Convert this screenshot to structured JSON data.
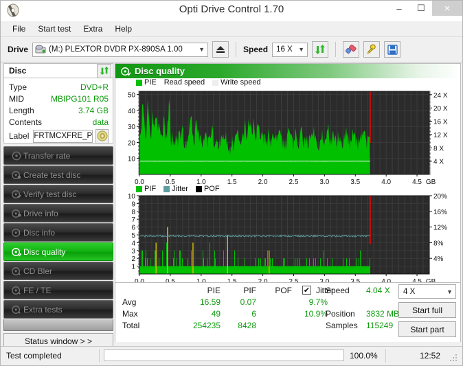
{
  "window": {
    "title": "Opti Drive Control 1.70",
    "icon": "disc-icon",
    "minimize": "–",
    "maximize": "☐",
    "close": "×"
  },
  "menu": {
    "items": [
      "File",
      "Start test",
      "Extra",
      "Help"
    ]
  },
  "toolbar": {
    "drive_label": "Drive",
    "drive_value": "(M:)   PLEXTOR DVDR   PX-890SA 1.00",
    "drive_icon": "drive-icon",
    "eject_icon": "eject-icon",
    "speed_label": "Speed",
    "speed_value": "16 X",
    "refresh_icon": "refresh-icon",
    "erase_icon": "erase-icon",
    "bitsetting_icon": "bitsetting-icon",
    "save_icon": "save-icon"
  },
  "disc": {
    "header": "Disc",
    "refresh_icon": "refresh-icon",
    "rows": [
      {
        "key": "Type",
        "value": "DVD+R"
      },
      {
        "key": "MID",
        "value": "MBIPG101 R05"
      },
      {
        "key": "Length",
        "value": "3.74 GB"
      },
      {
        "key": "Contents",
        "value": "data"
      }
    ],
    "label_key": "Label",
    "label_value": "FRTMCXFRE_P",
    "label_btn_icon": "disc-icon"
  },
  "sidebar": {
    "items": [
      {
        "label": "Transfer rate",
        "icon": "disc-icon",
        "active": false
      },
      {
        "label": "Create test disc",
        "icon": "disc-write-icon",
        "active": false
      },
      {
        "label": "Verify test disc",
        "icon": "disc-check-icon",
        "active": false
      },
      {
        "label": "Drive info",
        "icon": "drive-info-icon",
        "active": false
      },
      {
        "label": "Disc info",
        "icon": "disc-info-icon",
        "active": false
      },
      {
        "label": "Disc quality",
        "icon": "disc-quality-icon",
        "active": true
      },
      {
        "label": "CD Bler",
        "icon": "disc-bler-icon",
        "active": false
      },
      {
        "label": "FE / TE",
        "icon": "disc-fete-icon",
        "active": false
      },
      {
        "label": "Extra tests",
        "icon": "disc-extra-icon",
        "active": false
      }
    ],
    "status_window": "Status window > >"
  },
  "panel": {
    "title": "Disc quality",
    "icon": "disc-quality-icon"
  },
  "chart_data": [
    {
      "type": "bar",
      "name": "pie-chart",
      "title": "",
      "legend": [
        {
          "label": "PIE",
          "color": "#00c000"
        },
        {
          "label": "Read speed",
          "color": "#ffffff"
        },
        {
          "label": "Write speed",
          "color": "#e0e0e0"
        }
      ],
      "legend_position": "top-left",
      "xlabel": "GB",
      "ylabel": "PIE",
      "y2label": "Speed",
      "xlim": [
        0,
        4.7
      ],
      "ylim": [
        0,
        52
      ],
      "y2lim": [
        0,
        25
      ],
      "xticks": [
        "0.0",
        "0.5",
        "1.0",
        "1.5",
        "2.0",
        "2.5",
        "3.0",
        "3.5",
        "4.0",
        "4.5"
      ],
      "xtick_values": [
        0.0,
        0.5,
        1.0,
        1.5,
        2.0,
        2.5,
        3.0,
        3.5,
        4.0,
        4.5
      ],
      "xunit": "GB",
      "yticks": [
        "10",
        "20",
        "30",
        "40",
        "50"
      ],
      "ytick_values": [
        10,
        20,
        30,
        40,
        50
      ],
      "y2ticks": [
        "4 X",
        "8 X",
        "12 X",
        "16 X",
        "20 X",
        "24 X"
      ],
      "y2tick_values": [
        4,
        8,
        12,
        16,
        20,
        24
      ],
      "grid": true,
      "background": "#2b2b2b",
      "data_end_x": 3.74,
      "marker_line_x": 3.74,
      "marker_color": "#ff0000",
      "series": [
        {
          "name": "PIE",
          "color": "#00c000",
          "type": "bar",
          "x_start": 0.0,
          "x_end": 3.74,
          "baseline_values": [
            28,
            27,
            49,
            31,
            24,
            46,
            31,
            25,
            38,
            26,
            40,
            30,
            35,
            22,
            25,
            37,
            20,
            30,
            47,
            18,
            26,
            15,
            22,
            20,
            25,
            23,
            30,
            21,
            20,
            19,
            27,
            43,
            24,
            21,
            29,
            33,
            22,
            20,
            18,
            21,
            26,
            19,
            22,
            24,
            29,
            18,
            20,
            22,
            19,
            21,
            20,
            23,
            26,
            18,
            17,
            16,
            20,
            18,
            22,
            26,
            20,
            18,
            22,
            26,
            31,
            22,
            36,
            29,
            25,
            33,
            22,
            27,
            35,
            21,
            25,
            19,
            23,
            21,
            26,
            18,
            21,
            24,
            22,
            20,
            25,
            30,
            22,
            19,
            18,
            23,
            29,
            25,
            21,
            20,
            26,
            22,
            18,
            24,
            27,
            20,
            22,
            25,
            19,
            21,
            24,
            30,
            22,
            20,
            18,
            21,
            26,
            24,
            19,
            22,
            30,
            18,
            21,
            25,
            22,
            20,
            26,
            24,
            18,
            20,
            23,
            29,
            21,
            19,
            22,
            27,
            24,
            20,
            18,
            22,
            25,
            21,
            28,
            19,
            23,
            20
          ]
        },
        {
          "name": "Read speed",
          "color": "#ffffff",
          "type": "line",
          "axis": "y2",
          "value": 4.0,
          "x_start": 0.0,
          "x_end": 3.74
        }
      ],
      "stats": {
        "avg": 16.59,
        "max": 49,
        "total": 254235
      }
    },
    {
      "type": "bar",
      "name": "pif-chart",
      "title": "",
      "legend": [
        {
          "label": "PIF",
          "color": "#00c000"
        },
        {
          "label": "Jitter",
          "color": "#3f8f8f"
        },
        {
          "label": "POF",
          "color": "#000000"
        }
      ],
      "legend_position": "top-left",
      "xlabel": "GB",
      "ylabel": "PIF",
      "y2label": "Jitter",
      "xlim": [
        0,
        4.7
      ],
      "ylim": [
        0,
        10
      ],
      "y2lim": [
        0,
        20
      ],
      "xticks": [
        "0.0",
        "0.5",
        "1.0",
        "1.5",
        "2.0",
        "2.5",
        "3.0",
        "3.5",
        "4.0",
        "4.5"
      ],
      "xtick_values": [
        0.0,
        0.5,
        1.0,
        1.5,
        2.0,
        2.5,
        3.0,
        3.5,
        4.0,
        4.5
      ],
      "xunit": "GB",
      "yticks": [
        "1",
        "2",
        "3",
        "4",
        "5",
        "6",
        "7",
        "8",
        "9",
        "10"
      ],
      "ytick_values": [
        1,
        2,
        3,
        4,
        5,
        6,
        7,
        8,
        9,
        10
      ],
      "y2ticks": [
        "4%",
        "8%",
        "12%",
        "16%",
        "20%"
      ],
      "y2tick_values": [
        4,
        8,
        12,
        16,
        20
      ],
      "grid": true,
      "background": "#2b2b2b",
      "data_end_x": 3.74,
      "marker_line_x": 3.74,
      "marker_color": "#ff0000",
      "series": [
        {
          "name": "PIF",
          "color": "#00c000",
          "type": "bar",
          "x_start": 0.0,
          "x_end": 3.74,
          "baseline_values": [
            1,
            4,
            1,
            3,
            2,
            1,
            3,
            1,
            2,
            3,
            1,
            2,
            1,
            3,
            2,
            1,
            6,
            2,
            1,
            2,
            3,
            1,
            2,
            1,
            3,
            2,
            1,
            2,
            1,
            2,
            1,
            3,
            1,
            2,
            1,
            1,
            2,
            1,
            3,
            1,
            2,
            1,
            4,
            2,
            1,
            3,
            1,
            2,
            1,
            2,
            3,
            1,
            2,
            1,
            1,
            2,
            1,
            3,
            1,
            2,
            1,
            2,
            1,
            3,
            2,
            1,
            5,
            2,
            1,
            2,
            1,
            3,
            1,
            2,
            1,
            2,
            1,
            3,
            2,
            1,
            2,
            1,
            3,
            1,
            2,
            1,
            2,
            3,
            1,
            2,
            1,
            3,
            1,
            2,
            1,
            2,
            3,
            1,
            2,
            1,
            3,
            1,
            2,
            1,
            2,
            1,
            3,
            2,
            1,
            2,
            1,
            3,
            1,
            2,
            1,
            2,
            3,
            1,
            2,
            1,
            2,
            1,
            3,
            1,
            2,
            1,
            2,
            1,
            3,
            1,
            2,
            1,
            2,
            3,
            1,
            2,
            1,
            2,
            1,
            3
          ]
        },
        {
          "name": "Jitter",
          "color": "#5f9ea0",
          "type": "line",
          "axis": "y2",
          "value": 9.7,
          "x_start": 0.0,
          "x_end": 3.74
        }
      ],
      "stats": {
        "avg": 0.07,
        "max": 6,
        "total": 8428
      }
    }
  ],
  "stats_table": {
    "columns": [
      "PIE",
      "PIF",
      "POF"
    ],
    "rows": [
      {
        "label": "Avg",
        "pie": "16.59",
        "pif": "0.07",
        "pof": ""
      },
      {
        "label": "Max",
        "pie": "49",
        "pif": "6",
        "pof": ""
      },
      {
        "label": "Total",
        "pie": "254235",
        "pif": "8428",
        "pof": ""
      }
    ],
    "jitter": {
      "checkbox_label": "Jitter",
      "checked": true,
      "check_glyph": "✔",
      "avg": "9.7%",
      "max": "10.9%"
    },
    "info": [
      {
        "key": "Speed",
        "value": "4.04 X"
      },
      {
        "key": "Position",
        "value": "3832 MB"
      },
      {
        "key": "Samples",
        "value": "115249"
      }
    ],
    "speed_select": "4 X",
    "start_full": "Start full",
    "start_part": "Start part"
  },
  "statusbar": {
    "message": "Test completed",
    "progress_percent": 100.0,
    "progress_text": "100.0%",
    "time": "12:52"
  },
  "colors": {
    "green": "#00c000",
    "accent_green": "#0f9b0f",
    "marker_red": "#ff0000",
    "jitter": "#5f9ea0",
    "chart_bg": "#2b2b2b"
  }
}
